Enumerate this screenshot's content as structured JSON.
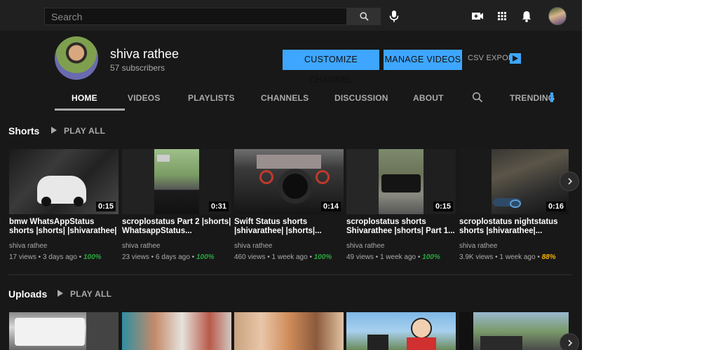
{
  "masthead": {
    "search_placeholder": "Search"
  },
  "channel": {
    "name": "shiva rathee",
    "subscribers": "57 subscribers",
    "customize_label": "CUSTOMIZE CHANNEL",
    "manage_label": "MANAGE VIDEOS",
    "csv_label": "CSV EXPORT"
  },
  "tabs": [
    "HOME",
    "VIDEOS",
    "PLAYLISTS",
    "CHANNELS",
    "DISCUSSION",
    "ABOUT",
    "TRENDING"
  ],
  "shorts": {
    "title": "Shorts",
    "play_all": "PLAY ALL",
    "videos": [
      {
        "duration": "0:15",
        "title": "bmw WhatsAppStatus shorts |shorts| |shivarathee|",
        "channel": "shiva rathee",
        "meta": "17 views • 3 days ago • ",
        "pct": "100%",
        "pct_color": "#2ba640"
      },
      {
        "duration": "0:31",
        "title": "scroplostatus Part 2 |shorts| WhatsappStatus...",
        "channel": "shiva rathee",
        "meta": "23 views • 6 days ago • ",
        "pct": "100%",
        "pct_color": "#2ba640"
      },
      {
        "duration": "0:14",
        "title": "Swift Status shorts |shivarathee| |shorts|...",
        "channel": "shiva rathee",
        "meta": "460 views • 1 week ago • ",
        "pct": "100%",
        "pct_color": "#2ba640"
      },
      {
        "duration": "0:15",
        "title": "scroplostatus shorts Shivarathee |shorts| Part 1...",
        "channel": "shiva rathee",
        "meta": "49 views • 1 week ago • ",
        "pct": "100%",
        "pct_color": "#2ba640"
      },
      {
        "duration": "0:16",
        "title": "scroplostatus nightstatus shorts |shivarathee|...",
        "channel": "shiva rathee",
        "meta": "3.9K views • 1 week ago • ",
        "pct": "88%",
        "pct_color": "#f4b400"
      }
    ]
  },
  "uploads": {
    "title": "Uploads",
    "play_all": "PLAY ALL"
  },
  "colors": {
    "accent": "#3ea6ff",
    "background": "#181818",
    "masthead": "#202020"
  }
}
